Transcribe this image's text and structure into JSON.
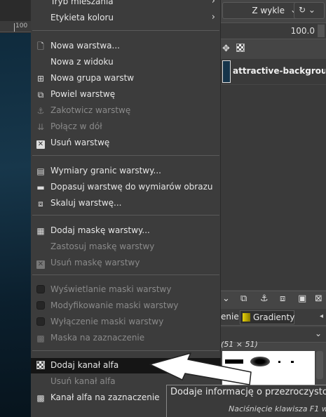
{
  "canvas": {
    "ruler_label": "100"
  },
  "right_panel": {
    "mode_value": "Z wykle",
    "opacity_value": "100.0",
    "layer_name": "attractive-background",
    "tab_partial": "enie",
    "tab_gradients": "Gradienty",
    "brush_size": "(51 × 51)"
  },
  "menu": {
    "items": [
      {
        "label": "Tryb mieszania",
        "icon": "none",
        "disabled": false,
        "submenu": true
      },
      {
        "label": "Etykieta koloru",
        "icon": "none",
        "disabled": false,
        "submenu": true
      },
      {
        "label": "Nowa warstwa...",
        "icon": "new-layer-icon",
        "disabled": false
      },
      {
        "label": "Nowa z widoku",
        "icon": "none",
        "disabled": false
      },
      {
        "label": "Nowa grupa warstw",
        "icon": "new-group-icon",
        "disabled": false
      },
      {
        "label": "Powiel warstwę",
        "icon": "duplicate-icon",
        "disabled": false
      },
      {
        "label": "Zakotwicz warstwę",
        "icon": "anchor-icon",
        "disabled": true
      },
      {
        "label": "Połącz w dół",
        "icon": "merge-down-icon",
        "disabled": true
      },
      {
        "label": "Usuń warstwę",
        "icon": "delete-icon",
        "disabled": false
      },
      {
        "label": "Wymiary granic warstwy...",
        "icon": "boundary-icon",
        "disabled": false
      },
      {
        "label": "Dopasuj warstwę do wymiarów obrazu",
        "icon": "fit-image-icon",
        "disabled": false
      },
      {
        "label": "Skaluj warstwę...",
        "icon": "scale-icon",
        "disabled": false
      },
      {
        "label": "Dodaj maskę warstwy...",
        "icon": "add-mask-icon",
        "disabled": false
      },
      {
        "label": "Zastosuj maskę warstwy",
        "icon": "none",
        "disabled": true
      },
      {
        "label": "Usuń maskę warstwy",
        "icon": "delete-icon",
        "disabled": true
      },
      {
        "label": "Wyświetlanie maski warstwy",
        "icon": "checkbox",
        "disabled": true
      },
      {
        "label": "Modyfikowanie maski warstwy",
        "icon": "checkbox",
        "disabled": true
      },
      {
        "label": "Wyłączenie maski warstwy",
        "icon": "checkbox",
        "disabled": true
      },
      {
        "label": "Maska na zaznaczenie",
        "icon": "mask-selection-icon",
        "disabled": true
      },
      {
        "label": "Dodaj kanał alfa",
        "icon": "alpha-icon",
        "disabled": false,
        "highlight": true
      },
      {
        "label": "Usuń kanał alfa",
        "icon": "none",
        "disabled": true
      },
      {
        "label": "Kanał alfa na zaznaczenie",
        "icon": "alpha-selection-icon",
        "disabled": false
      }
    ]
  },
  "tooltip": {
    "text": "Dodaje informację o przezroczystości",
    "hint": "Naciśnięcie klawisza F1 w"
  },
  "colors": {
    "menu_bg": "#3c3c3c",
    "highlight": "#151515",
    "disabled_text": "#8a8a8a"
  }
}
